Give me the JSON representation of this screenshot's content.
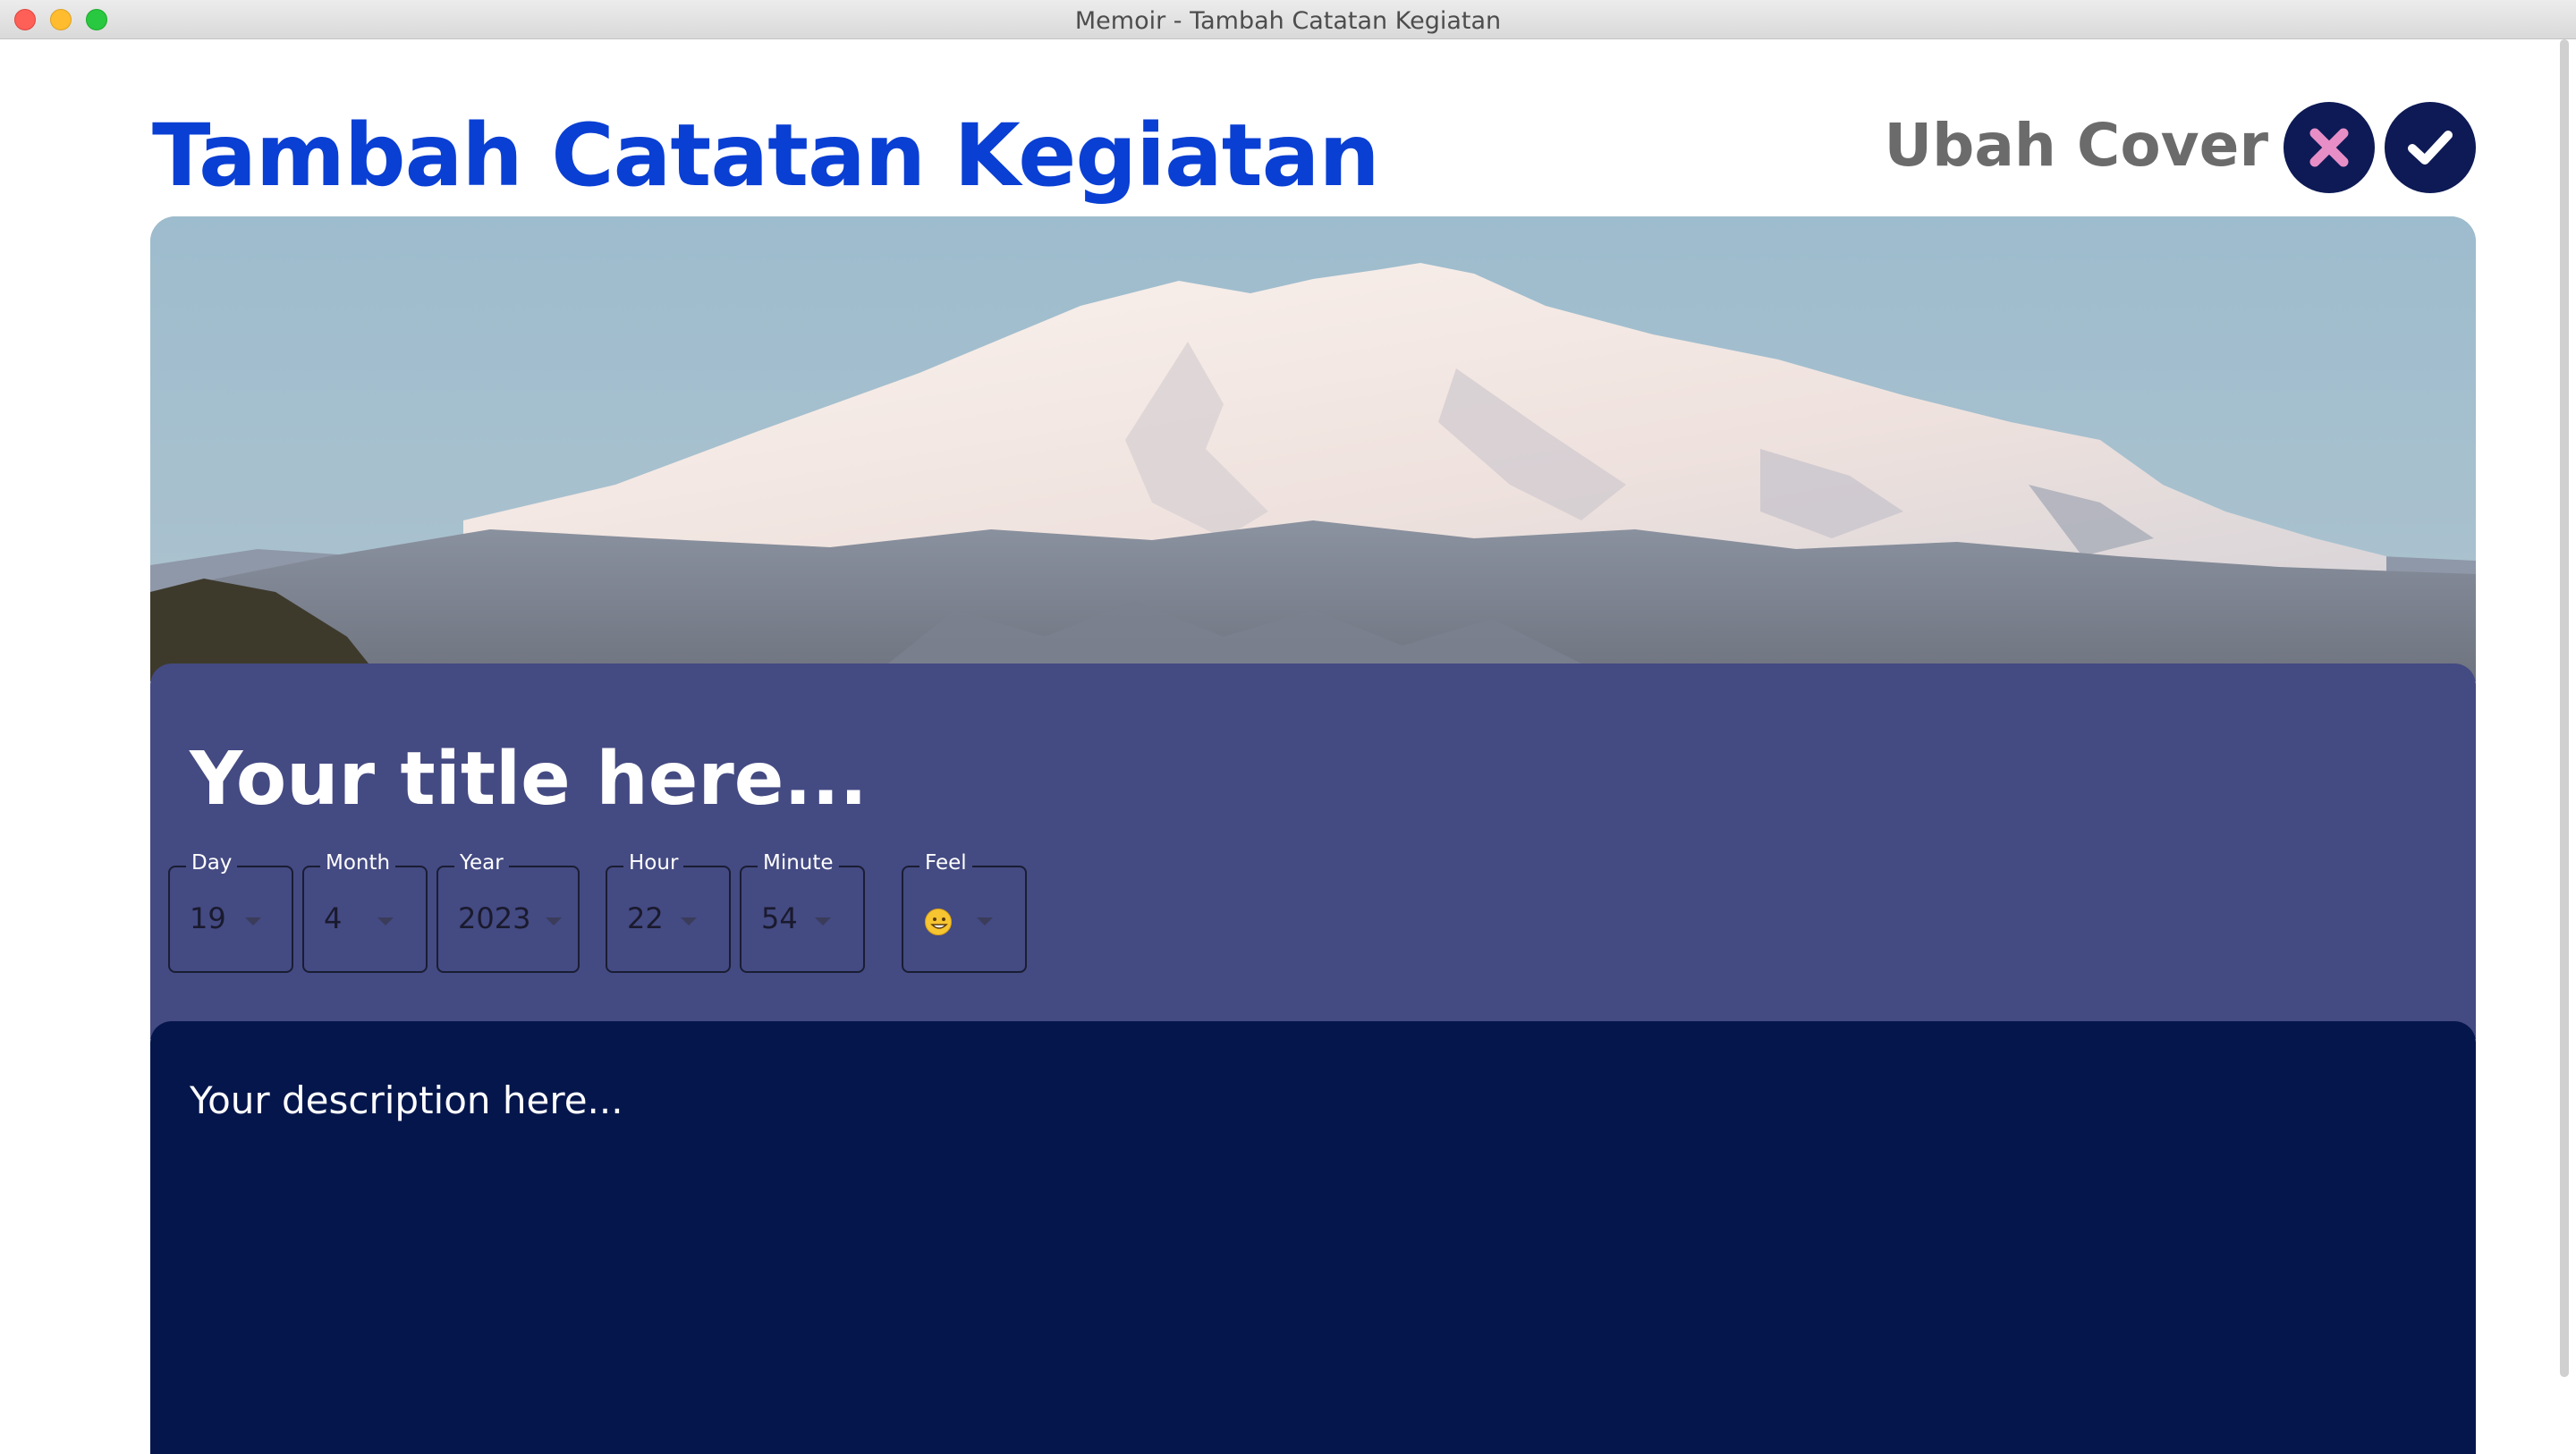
{
  "window": {
    "title": "Memoir - Tambah Catatan Kegiatan"
  },
  "header": {
    "title": "Tambah Catatan Kegiatan",
    "change_cover_label": "Ubah Cover",
    "cancel_icon": "close-icon",
    "confirm_icon": "checkmark-icon"
  },
  "cover": {
    "image": "snow-capped-mountain-photo"
  },
  "entry": {
    "title_placeholder": "Your title here...",
    "description_placeholder": "Your description here..."
  },
  "fields": {
    "day": {
      "label": "Day",
      "value": "19"
    },
    "month": {
      "label": "Month",
      "value": "4"
    },
    "year": {
      "label": "Year",
      "value": "2023"
    },
    "hour": {
      "label": "Hour",
      "value": "22"
    },
    "minute": {
      "label": "Minute",
      "value": "54"
    },
    "feel": {
      "label": "Feel",
      "value": "grinning-face-emoji"
    }
  },
  "colors": {
    "title_blue": "#0a3fd4",
    "button_navy": "#0d1a55",
    "cancel_pink": "#e88ec7",
    "title_section": "#444a82",
    "desc_section": "#05164c"
  }
}
